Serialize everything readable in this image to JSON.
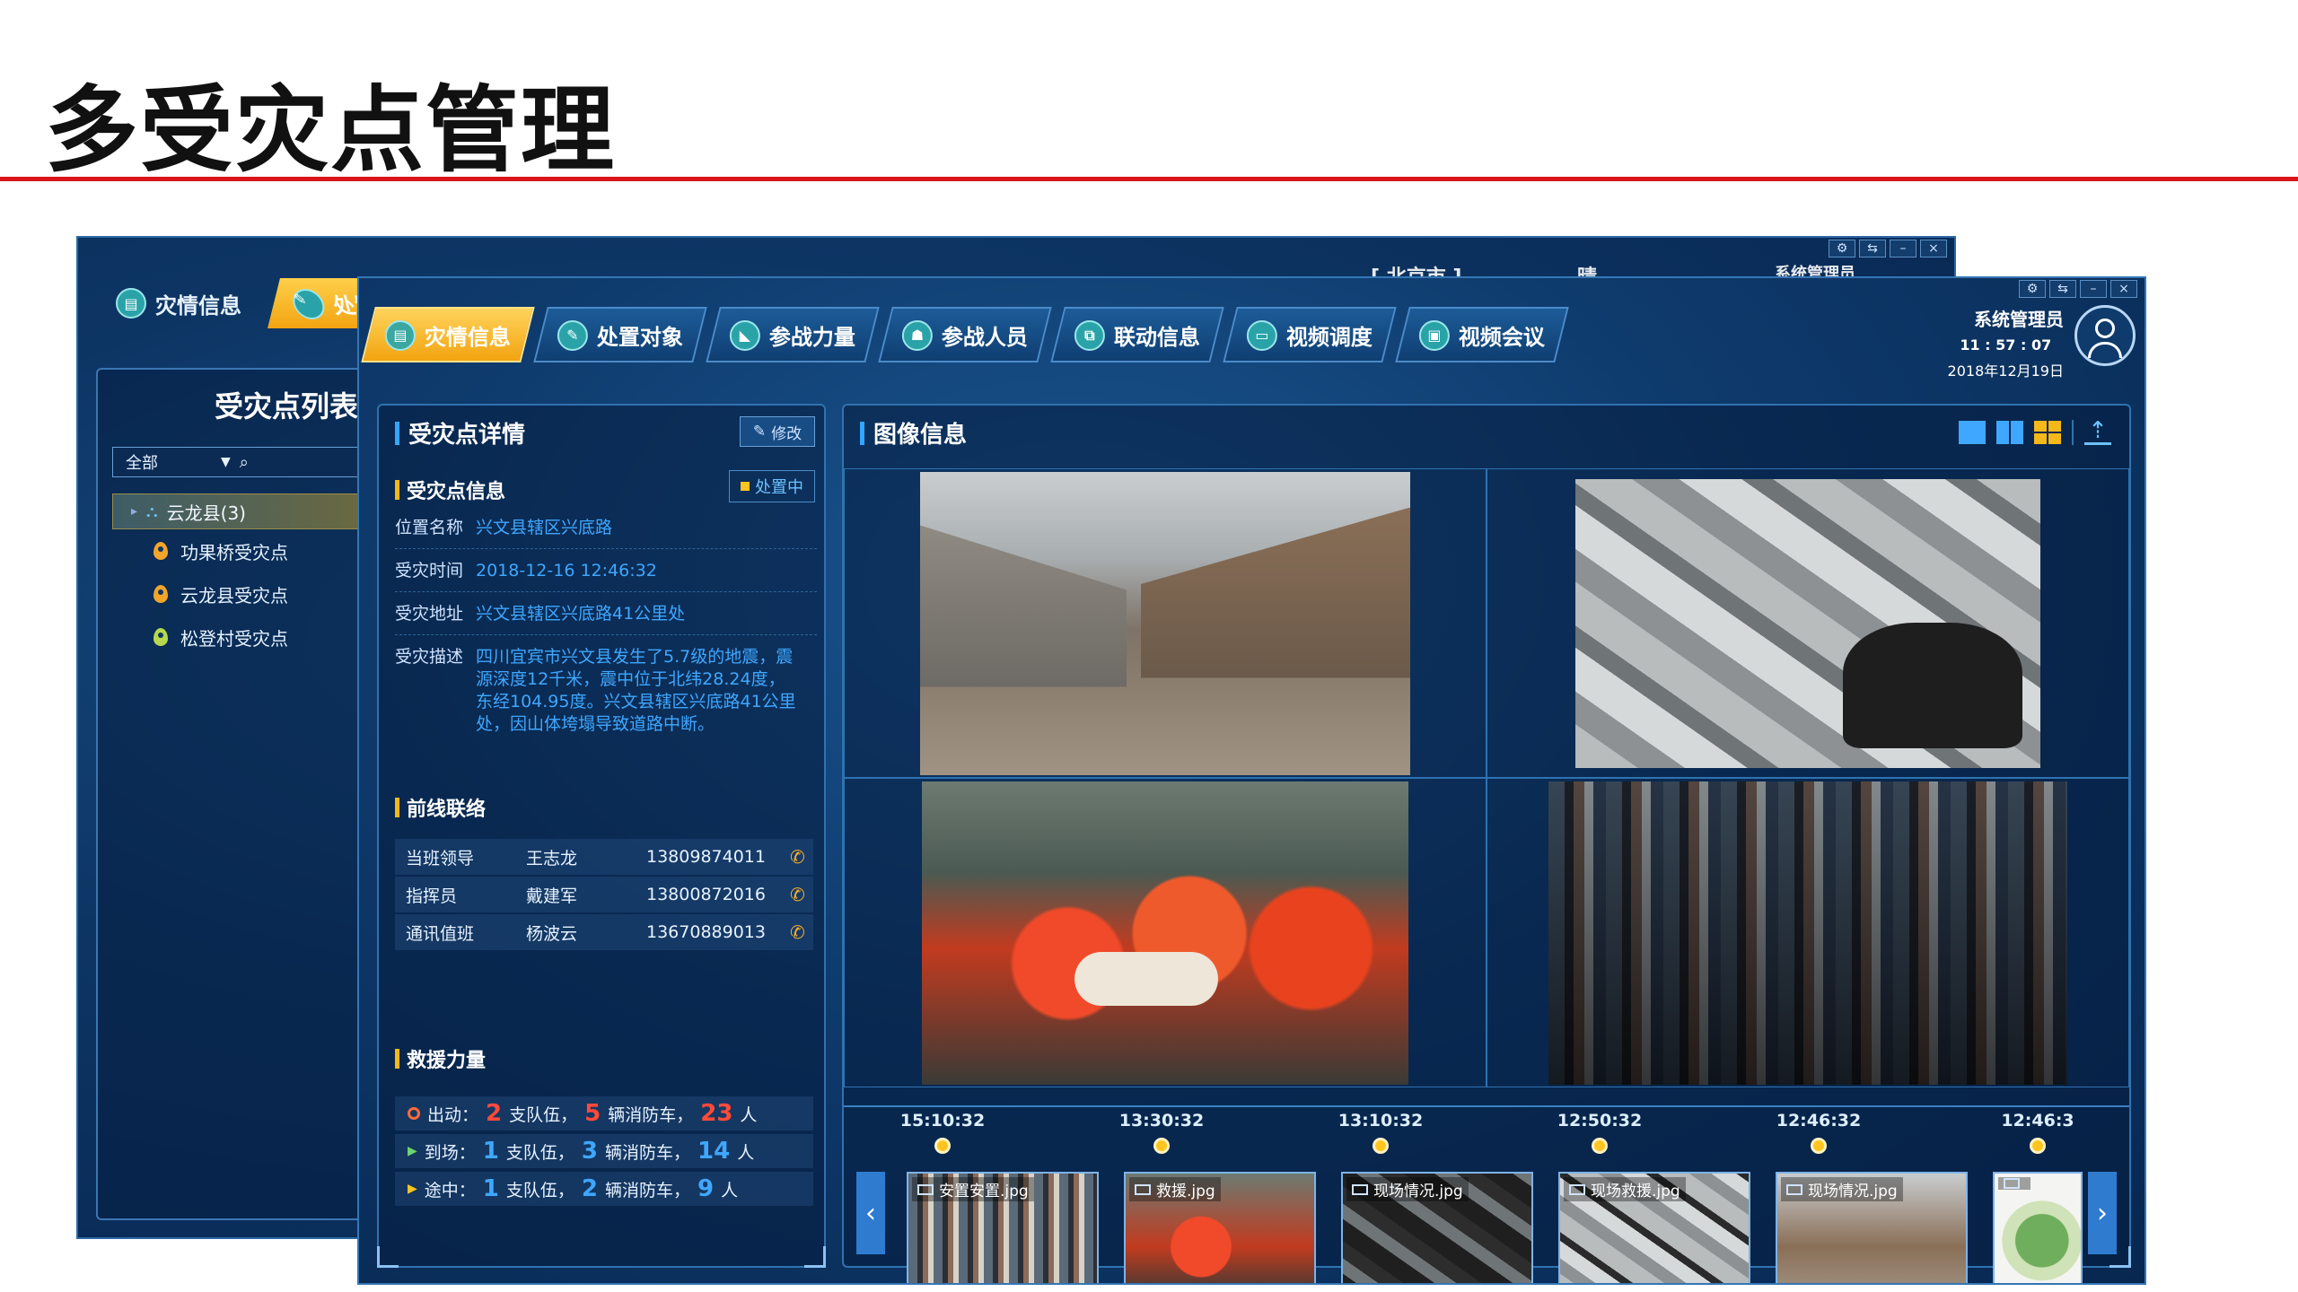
{
  "slide": {
    "title": "多受灾点管理"
  },
  "back_window": {
    "tabs": [
      {
        "label": "灾情信息",
        "icon": "document-icon"
      },
      {
        "label": "处置",
        "icon": "chat-icon"
      }
    ],
    "top_texts": [
      "[ 北京市 ]",
      "晴",
      "系统管理员"
    ],
    "panel_title": "受灾点列表",
    "filter_value": "全部",
    "tree": {
      "root": "云龙县(3)",
      "items": [
        "功果桥受灾点",
        "云龙县受灾点",
        "松登村受灾点"
      ]
    }
  },
  "front_window": {
    "nav": [
      {
        "label": "灾情信息",
        "icon": "document-icon",
        "active": true
      },
      {
        "label": "处置对象",
        "icon": "chat-icon",
        "active": false
      },
      {
        "label": "参战力量",
        "icon": "truck-icon",
        "active": false
      },
      {
        "label": "参战人员",
        "icon": "user-group-icon",
        "active": false
      },
      {
        "label": "联动信息",
        "icon": "link-icon",
        "active": false
      },
      {
        "label": "视频调度",
        "icon": "monitor-icon",
        "active": false
      },
      {
        "label": "视频会议",
        "icon": "meeting-icon",
        "active": false
      }
    ],
    "window_controls": [
      "⚙",
      "⇆",
      "–",
      "×"
    ],
    "user": {
      "name": "系统管理员",
      "time": "11 : 57 : 07",
      "date": "2018年12月19日"
    },
    "detail": {
      "title": "受灾点详情",
      "edit_label": "修改",
      "info_title": "受灾点信息",
      "status": "处置中",
      "fields": [
        {
          "label": "位置名称",
          "value": "兴文县辖区兴底路"
        },
        {
          "label": "受灾时间",
          "value": "2018-12-16 12:46:32"
        },
        {
          "label": "受灾地址",
          "value": "兴文县辖区兴底路41公里处"
        },
        {
          "label": "受灾描述",
          "value": "四川宜宾市兴文县发生了5.7级的地震，震源深度12千米，震中位于北纬28.24度，东经104.95度。兴文县辖区兴底路41公里处，因山体垮塌导致道路中断。"
        }
      ],
      "contacts_title": "前线联络",
      "contacts": [
        {
          "role": "当班领导",
          "name": "王志龙",
          "phone": "13809874011"
        },
        {
          "role": "指挥员",
          "name": "戴建军",
          "phone": "13800872016"
        },
        {
          "role": "通讯值班",
          "name": "杨波云",
          "phone": "13670889013"
        }
      ],
      "forces_title": "救援力量",
      "forces": [
        {
          "status": "出动：",
          "teams": "2",
          "teams_unit": "支队伍，",
          "trucks": "5",
          "trucks_unit": "辆消防车，",
          "people": "23",
          "people_unit": "人"
        },
        {
          "status": "到场：",
          "teams": "1",
          "teams_unit": "支队伍，",
          "trucks": "3",
          "trucks_unit": "辆消防车，",
          "people": "14",
          "people_unit": "人"
        },
        {
          "status": "途中：",
          "teams": "1",
          "teams_unit": "支队伍，",
          "trucks": "2",
          "trucks_unit": "辆消防车，",
          "people": "9",
          "people_unit": "人"
        }
      ]
    },
    "images": {
      "title": "图像信息",
      "timeline": [
        "15:10:32",
        "13:30:32",
        "13:10:32",
        "12:50:32",
        "12:46:32",
        "12:46:3"
      ],
      "thumbs": [
        {
          "label": "安置安置.jpg"
        },
        {
          "label": "救援.jpg"
        },
        {
          "label": "现场情况.jpg"
        },
        {
          "label": "现场救援.jpg"
        },
        {
          "label": "现场情况.jpg"
        },
        {
          "label": ""
        }
      ]
    }
  }
}
